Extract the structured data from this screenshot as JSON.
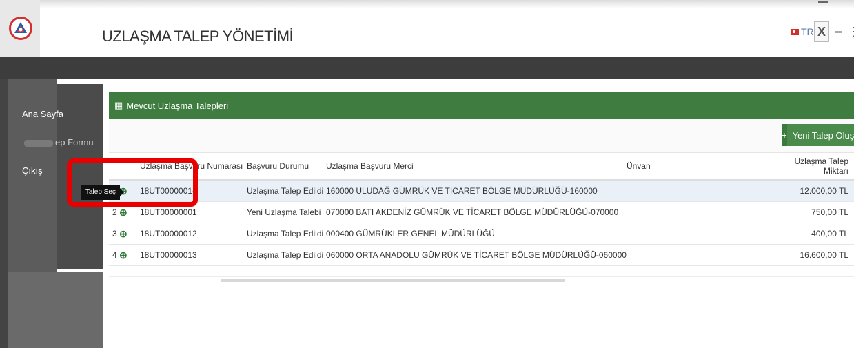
{
  "app": {
    "title": "UZLAŞMA TALEP YÖNETİMİ",
    "lang": "TR",
    "tool_glyph": "X",
    "kebab": "⋮"
  },
  "sidebar": {
    "items": [
      {
        "label": "Ana Sayfa"
      },
      {
        "label": "ep Formu"
      },
      {
        "label": "Çıkış"
      }
    ]
  },
  "panel": {
    "title": "Mevcut Uzlaşma Talepleri",
    "new_button_label": "Yeni Talep Oluştur",
    "new_button_icon": "plus-icon"
  },
  "table": {
    "columns": [
      "",
      "",
      "Uzlaşma Başvuru Numarası",
      "Başvuru Durumu",
      "Uzlaşma Başvuru Merci",
      "Ünvan",
      "Uzlaşma Talep Miktarı"
    ],
    "rows": [
      {
        "index": "1",
        "number": "18UT00000014",
        "status": "Uzlaşma Talep Edildi",
        "merci": "160000 ULUDAĞ GÜMRÜK VE TİCARET BÖLGE MÜDÜRLÜĞÜ-160000",
        "unvan": "",
        "amount": "12.000,00 TL"
      },
      {
        "index": "2",
        "number": "18UT00000001",
        "status": "Yeni Uzlaşma Talebi",
        "merci": "070000 BATI AKDENİZ GÜMRÜK VE TİCARET BÖLGE MÜDÜRLÜĞÜ-070000",
        "unvan": "",
        "amount": "750,00 TL"
      },
      {
        "index": "3",
        "number": "18UT00000012",
        "status": "Uzlaşma Talep Edildi",
        "merci": "000400 GÜMRÜKLER GENEL MÜDÜRLÜĞÜ",
        "unvan": "",
        "amount": "400,00 TL"
      },
      {
        "index": "4",
        "number": "18UT00000013",
        "status": "Uzlaşma Talep Edildi",
        "merci": "060000 ORTA ANADOLU GÜMRÜK VE TİCARET BÖLGE MÜDÜRLÜĞÜ-060000",
        "unvan": "",
        "amount": "16.600,00 TL"
      }
    ]
  },
  "tooltip": {
    "text": "Talep Seç"
  },
  "colors": {
    "header_green": "#3e7c3f",
    "highlight_red": "#e80000",
    "sidebar_dark": "#4b4b4b"
  }
}
